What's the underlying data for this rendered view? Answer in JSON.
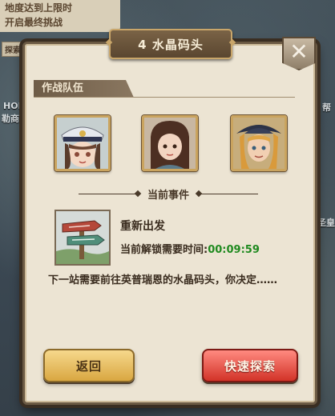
{
  "background": {
    "note_lines": [
      "地度达到上限时",
      "开启最终挑战"
    ],
    "labels": [
      "探索",
      "HOP",
      "勒商店",
      "帮",
      "圣皇"
    ]
  },
  "dialog": {
    "title": "4 水晶码头",
    "close_label": "✕",
    "team_section": "作战队伍",
    "event_header": "当前事件",
    "event_name": "重新出发",
    "unlock_label": "当前解锁需要时间:",
    "unlock_time": "00:09:59",
    "description": "下一站需要前往英普瑞恩的水晶码头，你决定……",
    "back_button": "返回",
    "quick_explore_button": "快速探索"
  },
  "colors": {
    "dialog_bg": "#ece4d3",
    "timer_green": "#1f8a1f",
    "back_button": "#e8bd5b",
    "quick_button": "#e2473b"
  }
}
